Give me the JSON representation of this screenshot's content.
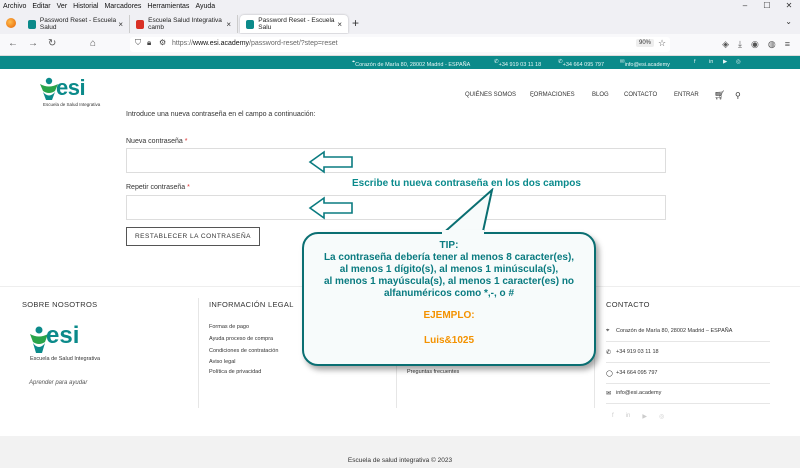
{
  "browser": {
    "menu": [
      "Archivo",
      "Editar",
      "Ver",
      "Historial",
      "Marcadores",
      "Herramientas",
      "Ayuda"
    ],
    "tabs": [
      {
        "title": "Password Reset - Escuela Salud",
        "fav_color": "#0b8a8a",
        "active": false
      },
      {
        "title": "Escuela Salud Integrativa camb",
        "fav_color": "#d93025",
        "active": false
      },
      {
        "title": "Password Reset - Escuela Salu",
        "fav_color": "#0b8a8a",
        "active": true
      }
    ],
    "url_prefix": "https://",
    "url_host": "www.esi.academy",
    "url_path": "/password-reset/?step=reset",
    "zoom": "90%"
  },
  "site": {
    "topbar": {
      "address": "Corazón de María 80, 28002 Madrid - ESPAÑA",
      "phone1": "+34 919 03 11 18",
      "phone2": "+34 664 095 797",
      "email": "info@esi.academy"
    },
    "logo_word": "esi",
    "logo_tagline": "Escuela de Salud Integrativa",
    "nav": [
      "QUIÉNES SOMOS",
      "FORMACIONES",
      "BLOG",
      "CONTACTO",
      "ENTRAR"
    ]
  },
  "form": {
    "intro": "Introduce una nueva contraseña en el campo a continuación:",
    "new_password_label": "Nueva contraseña",
    "repeat_password_label": "Repetir contraseña",
    "required_mark": "*",
    "submit": "RESTABLECER LA CONTRASEÑA"
  },
  "annotation": {
    "title": "Escribe tu nueva contraseña en los dos campos",
    "tip_heading": "TIP:",
    "tip_lines": [
      "La contraseña debería tener al menos 8 caracter(es),",
      "al menos 1 dígito(s), al menos 1 minúscula(s),",
      "al menos 1 mayúscula(s), al menos 1 caracter(es) no",
      "alfanuméricos como *,-, o #"
    ],
    "example_heading": "EJEMPLO:",
    "example_value": "Luis&1025",
    "color_text": "#0a7b80",
    "color_example": "#f39200"
  },
  "footer": {
    "about_title": "SOBRE NOSOTROS",
    "tagline": "Aprender para ayudar",
    "legal_title": "INFORMACIÓN LEGAL",
    "legal_links": [
      "Formas de pago",
      "Ayuda proceso de compra",
      "Condiciones de contratación",
      "Aviso legal",
      "Política de privacidad"
    ],
    "faq_link": "Preguntas frecuentes",
    "contact_title": "CONTACTO",
    "contact_address": "Corazón de María 80, 28002 Madrid – ESPAÑA",
    "contact_phone1": "+34 919 03 11 18",
    "contact_phone2": "+34 664 095 797",
    "contact_email": "info@esi.academy",
    "copyright": "Escuela de salud integrativa © 2023"
  }
}
